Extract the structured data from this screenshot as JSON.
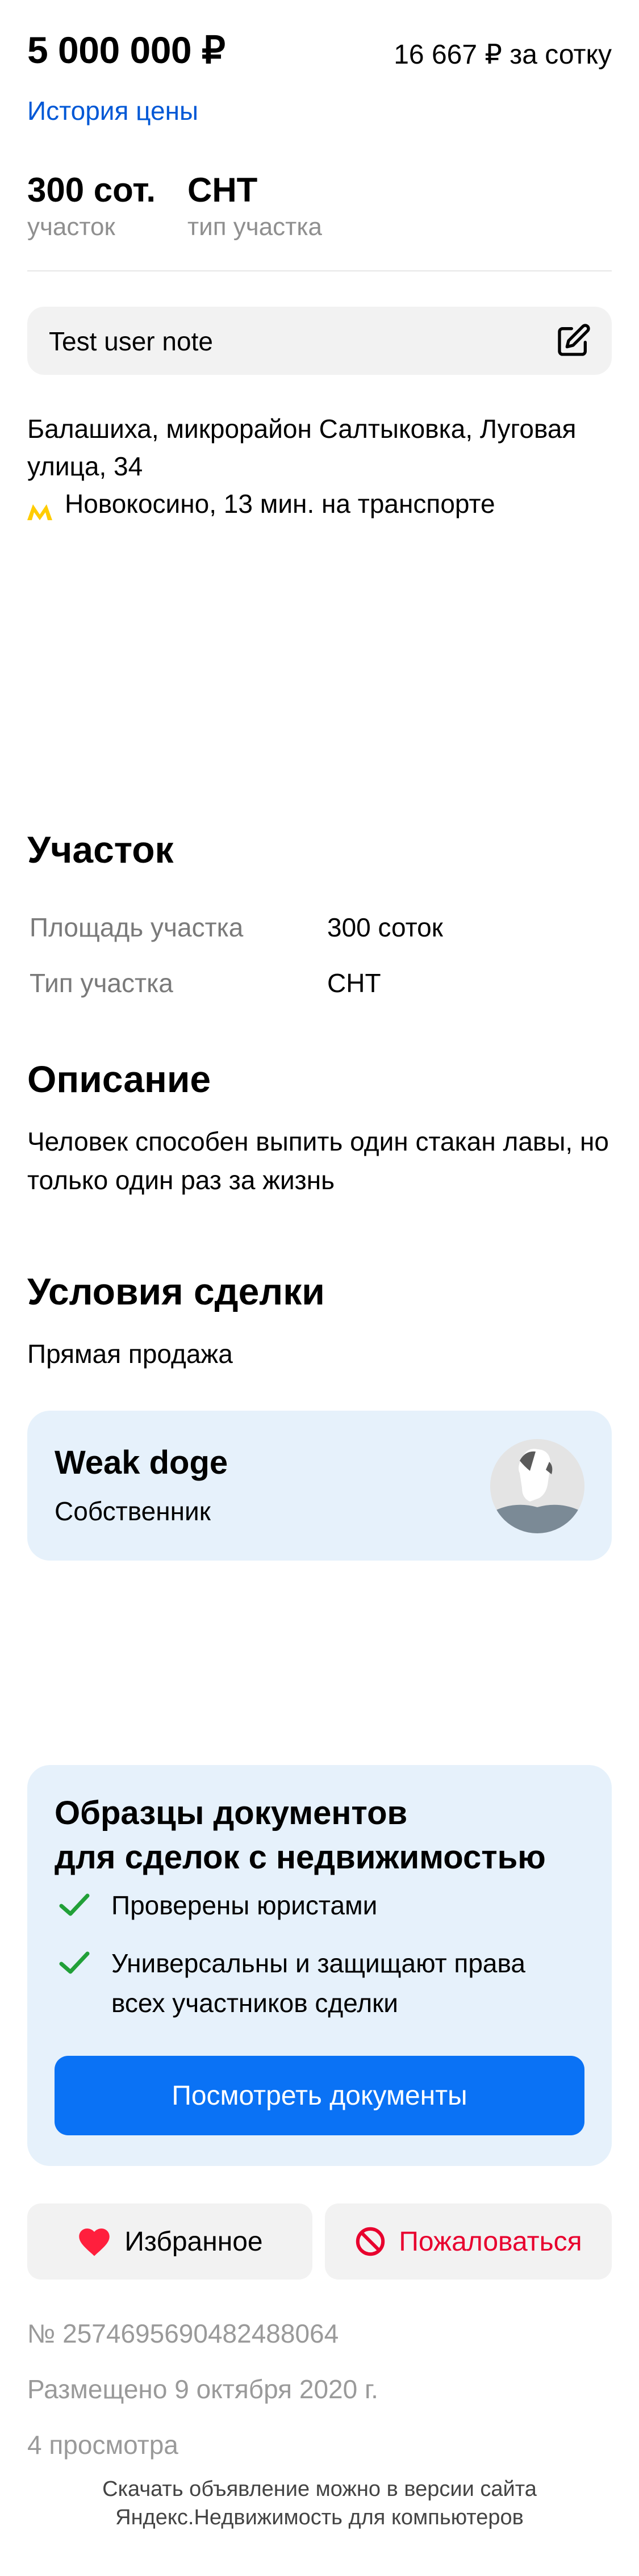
{
  "price": {
    "total": "5 000 000 ₽",
    "per_unit": "16 667 ₽ за сотку",
    "history_link": "История цены"
  },
  "params": [
    {
      "value": "300 сот.",
      "label": "участок"
    },
    {
      "value": "СНТ",
      "label": "тип участка"
    }
  ],
  "note": {
    "text": "Test user note",
    "icon": "edit-icon"
  },
  "location": {
    "address": "Балашиха, микрорайон Салтыковка, Луговая улица, 34",
    "metro": "Новокосино, 13 мин. на транспорте",
    "metro_color": "#ffcc00"
  },
  "plot": {
    "title": "Участок",
    "rows": [
      {
        "label": "Площадь участка",
        "value": "300 соток"
      },
      {
        "label": "Тип участка",
        "value": "СНТ"
      }
    ]
  },
  "description": {
    "title": "Описание",
    "text": "Человек способен выпить один стакан лавы, но только один раз за жизнь"
  },
  "deal": {
    "title": "Условия сделки",
    "text": "Прямая продажа"
  },
  "owner": {
    "name": "Weak doge",
    "role": "Собственник"
  },
  "docs": {
    "title_line1": "Образцы документов",
    "title_line2": "для сделок с недвижимостью",
    "items": [
      "Проверены юристами",
      "Универсальны и защищают права всех участников сделки"
    ],
    "button": "Посмотреть документы",
    "check_color": "#21a038",
    "button_color": "#0a72f5"
  },
  "actions": {
    "favorite": "Избранное",
    "complain": "Пожаловаться",
    "favorite_icon": "heart-icon",
    "complain_icon": "block-icon",
    "favorite_color": "#ff1f3d",
    "complain_color": "#e8002e"
  },
  "meta": {
    "id": "№ 2574695690482488064",
    "published": "Размещено 9 октября 2020 г.",
    "views": "4 просмотра"
  },
  "footer": {
    "line1": "Скачать объявление можно в версии сайта",
    "line2": "Яндекс.Недвижимость для компьютеров"
  }
}
